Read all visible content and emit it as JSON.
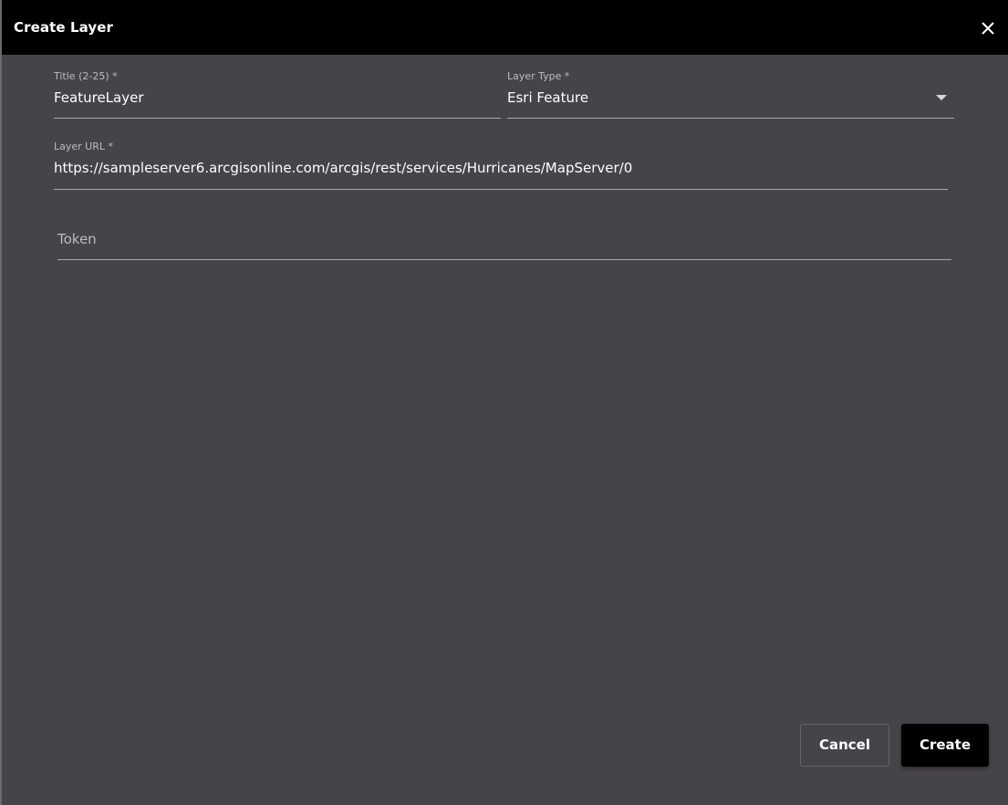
{
  "dialog": {
    "title": "Create Layer",
    "close_icon": "close-icon"
  },
  "form": {
    "title_field": {
      "label": "Title (2-25) *",
      "value": "FeatureLayer"
    },
    "layer_type_field": {
      "label": "Layer Type *",
      "value": "Esri Feature",
      "icon": "chevron-down-icon"
    },
    "layer_url_field": {
      "label": "Layer URL *",
      "value": "https://sampleserver6.arcgisonline.com/arcgis/rest/services/Hurricanes/MapServer/0"
    },
    "token_field": {
      "placeholder": "Token",
      "value": ""
    }
  },
  "actions": {
    "cancel_label": "Cancel",
    "create_label": "Create"
  },
  "colors": {
    "titlebar": "#000000",
    "body": "#464349",
    "primary_button": "#000000",
    "text": "#ffffff",
    "muted_text": "#bdbac0"
  }
}
